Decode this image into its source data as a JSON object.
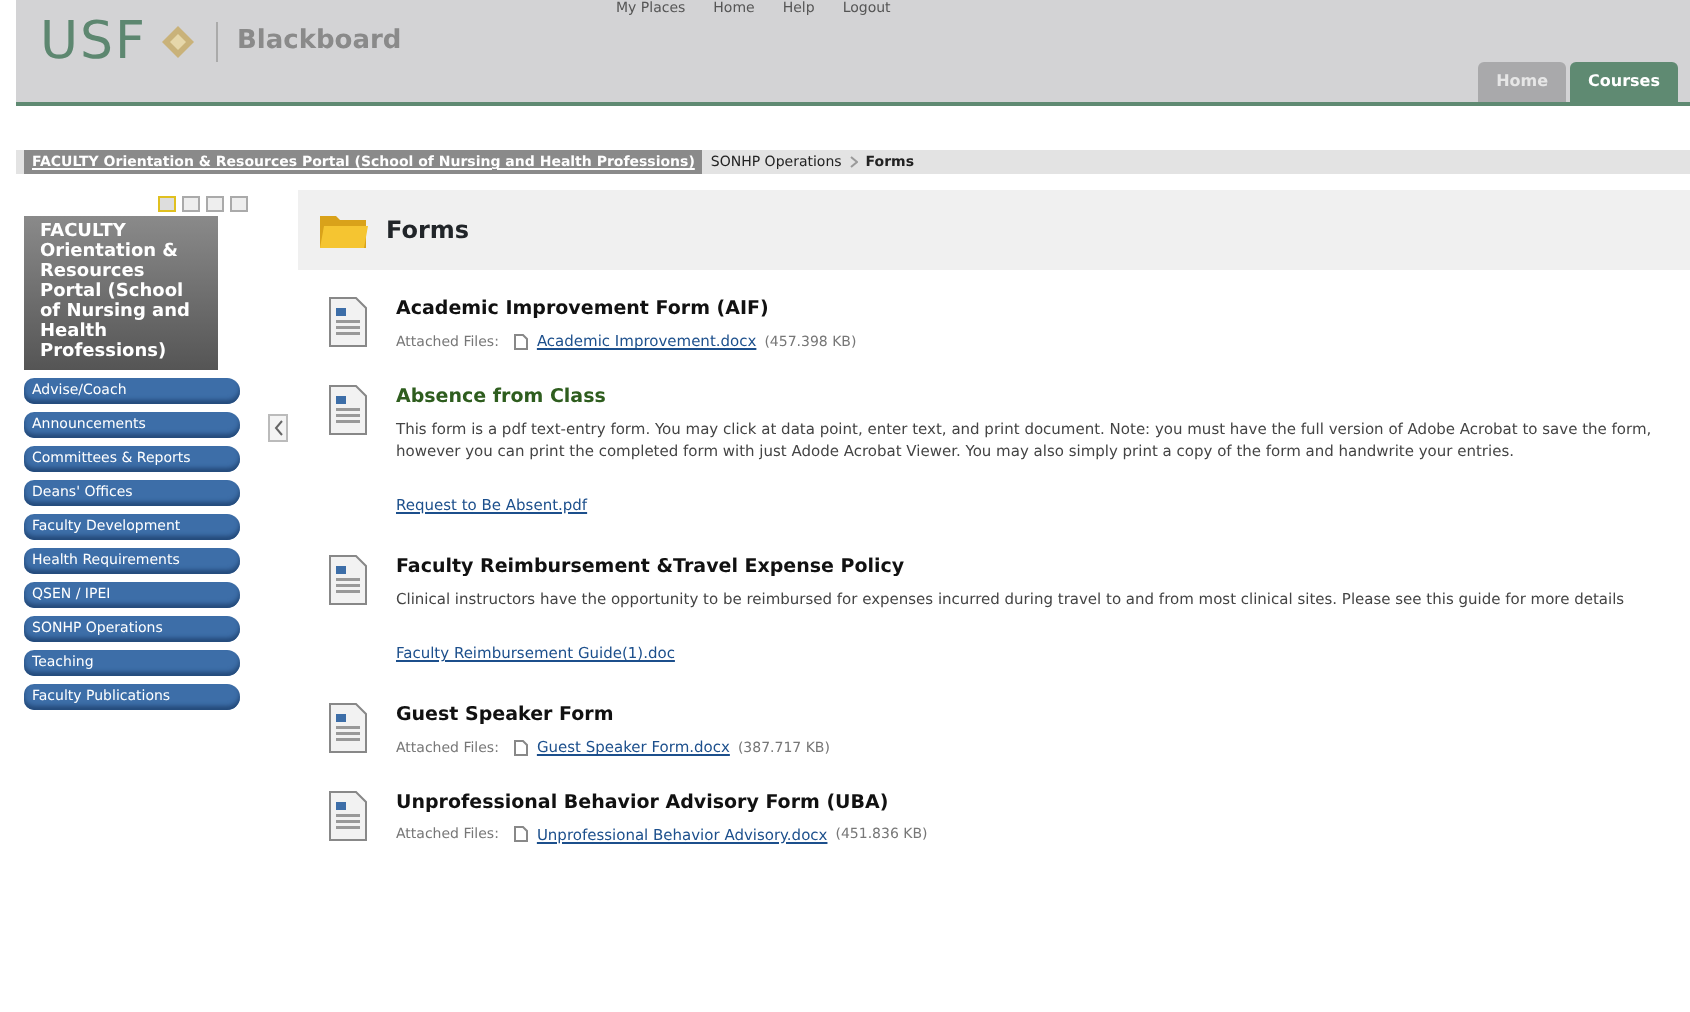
{
  "top_links": [
    "My Places",
    "Home",
    "Help",
    "Logout"
  ],
  "logo": {
    "text": "USF",
    "product": "Blackboard"
  },
  "tabs": [
    {
      "label": "Home",
      "selected": false
    },
    {
      "label": "Courses",
      "selected": true
    }
  ],
  "breadcrumb": [
    "FACULTY Orientation & Resources Portal (School of Nursing and Health Professions)",
    "SONHP Operations",
    "Forms"
  ],
  "course_menu": {
    "view_options": [
      {
        "selected": true
      },
      {
        "selected": false
      },
      {
        "selected": false
      },
      {
        "selected": false
      }
    ],
    "title": "FACULTY Orientation & Resources Portal (School of Nursing and Health Professions)",
    "items": [
      "Advise/Coach",
      "Announcements",
      "Committees & Reports",
      "Deans' Offices",
      "Faculty Development",
      "Health Requirements",
      "QSEN / IPEI",
      "SONHP Operations",
      "Teaching",
      "Faculty Publications"
    ]
  },
  "page_title": "Forms",
  "items": [
    {
      "kind": "attached",
      "title": "Academic Improvement Form (AIF)",
      "highlighted": false,
      "files_label": "Attached Files:",
      "file": "Academic Improvement.docx",
      "size": "(457.398 KB)"
    },
    {
      "kind": "description",
      "title": "Absence from Class",
      "highlighted": true,
      "text": "This form is a pdf text-entry form. You may click at data point, enter text, and print document. Note: you must have the full version of Adobe Acrobat to save the form, however you can print the completed form with just Adode Acrobat Viewer. You may also simply print a copy of the form and handwrite your entries.",
      "link": "Request to Be Absent.pdf"
    },
    {
      "kind": "description",
      "title": "Faculty Reimbursement &Travel Expense Policy",
      "highlighted": false,
      "text": "Clinical instructors have the opportunity to be reimbursed for expenses incurred during travel to and from most clinical sites.  Please see this guide for more details",
      "link": "Faculty Reimbursement Guide(1).doc"
    },
    {
      "kind": "attached",
      "title": "Guest Speaker Form",
      "highlighted": false,
      "files_label": "Attached Files:",
      "file": "Guest Speaker Form.docx",
      "size": "(387.717 KB)"
    },
    {
      "kind": "attached",
      "title": "Unprofessional Behavior Advisory Form (UBA)",
      "highlighted": false,
      "files_label": "Attached Files:",
      "file": "Unprofessional Behavior Advisory.docx",
      "size": "(451.836 KB)"
    }
  ]
}
